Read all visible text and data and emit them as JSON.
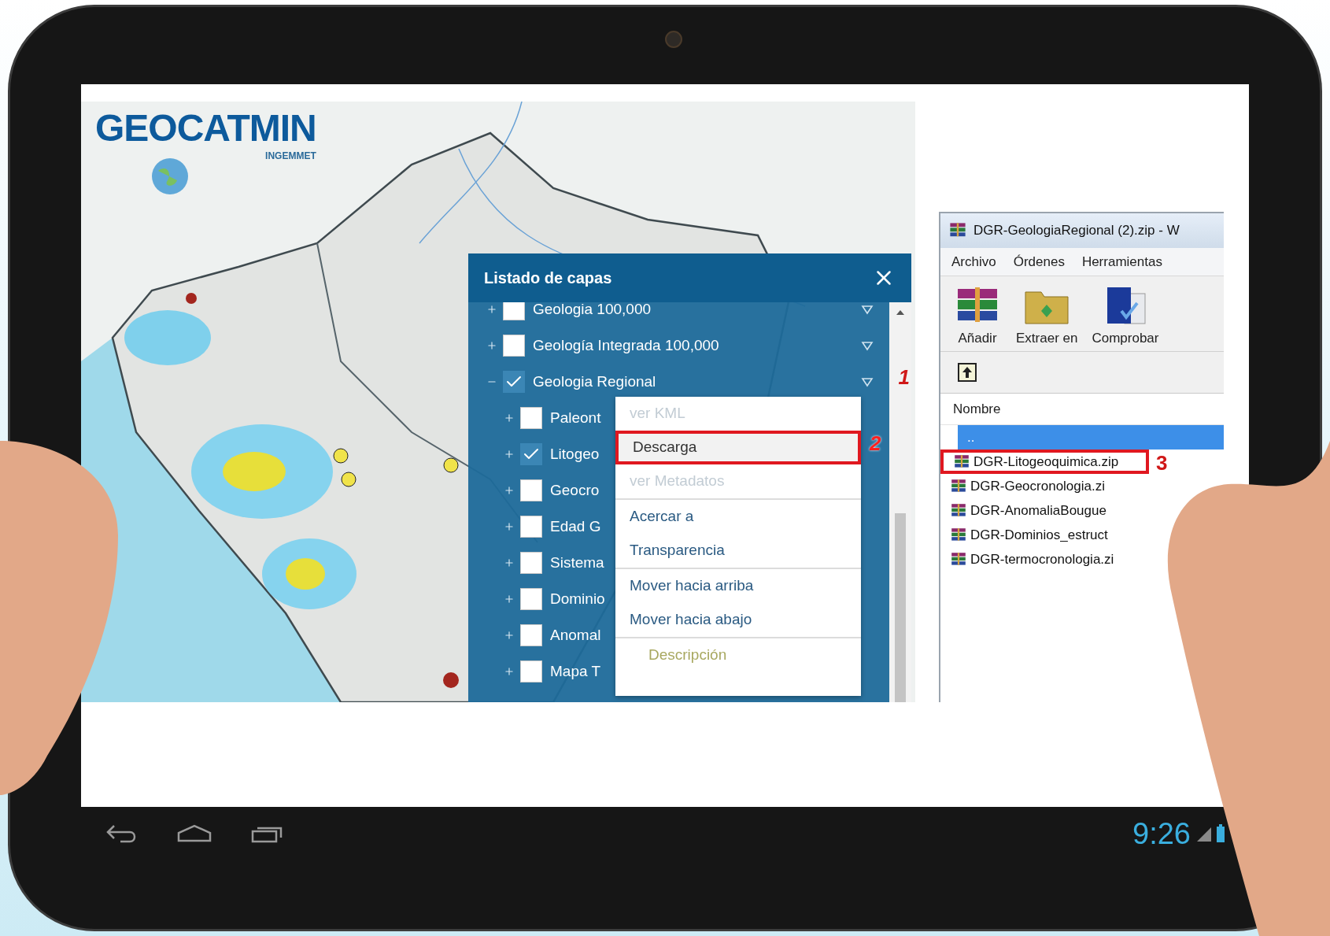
{
  "logo": {
    "name": "GEOCATMIN",
    "subtitle": "INGEMMET"
  },
  "layer_panel": {
    "title": "Listado de capas",
    "layers": [
      {
        "label": "Geologia 100,000",
        "checked": false,
        "expanded": false
      },
      {
        "label": "Geología Integrada 100,000",
        "checked": false,
        "expanded": false
      },
      {
        "label": "Geologia Regional",
        "checked": true,
        "expanded": true,
        "children": [
          {
            "label": "Paleont",
            "checked": false,
            "expanded": false
          },
          {
            "label": "Litogeo",
            "checked": true,
            "expanded": false
          },
          {
            "label": "Geocro",
            "checked": false,
            "expanded": false
          },
          {
            "label": "Edad G",
            "checked": false,
            "expanded": false
          },
          {
            "label": "Sistema",
            "checked": false,
            "expanded": false
          },
          {
            "label": "Dominio",
            "checked": false,
            "expanded": false
          },
          {
            "label": "Anomal",
            "checked": false,
            "expanded": false
          },
          {
            "label": "Mapa T",
            "checked": false,
            "expanded": false
          }
        ]
      }
    ],
    "context_menu": [
      [
        {
          "label": "ver KML",
          "kind": "item",
          "disabled": true,
          "highlighted": false
        },
        {
          "label": "Descarga",
          "kind": "item",
          "disabled": false,
          "highlighted": true
        },
        {
          "label": "ver Metadatos",
          "kind": "item",
          "disabled": true,
          "highlighted": false
        }
      ],
      [
        {
          "label": "Acercar a",
          "kind": "item",
          "disabled": false,
          "highlighted": false
        },
        {
          "label": "Transparencia",
          "kind": "item",
          "disabled": false,
          "highlighted": false
        }
      ],
      [
        {
          "label": "Mover hacia arriba",
          "kind": "item",
          "disabled": false,
          "highlighted": false
        },
        {
          "label": "Mover hacia abajo",
          "kind": "item",
          "disabled": false,
          "highlighted": false
        }
      ],
      [
        {
          "label": "Descripción",
          "kind": "heading",
          "disabled": false,
          "highlighted": false
        }
      ]
    ]
  },
  "annotations": [
    "1",
    "2",
    "3"
  ],
  "archive_window": {
    "title": "DGR-GeologiaRegional (2).zip - W",
    "menu": [
      "Archivo",
      "Órdenes",
      "Herramientas"
    ],
    "tools": [
      {
        "label": "Añadir",
        "kind": "add"
      },
      {
        "label": "Extraer en",
        "kind": "extract"
      },
      {
        "label": "Comprobar",
        "kind": "test"
      }
    ],
    "column": "Nombre",
    "files": [
      {
        "name": "..",
        "kind": "folder",
        "selected": true,
        "highlighted": false
      },
      {
        "name": "DGR-Litogeoquimica.zip",
        "kind": "archive",
        "selected": false,
        "highlighted": true
      },
      {
        "name": "DGR-Geocronologia.zi",
        "kind": "archive",
        "selected": false,
        "highlighted": false
      },
      {
        "name": "DGR-AnomaliaBougue",
        "kind": "archive",
        "selected": false,
        "highlighted": false
      },
      {
        "name": "DGR-Dominios_estruct",
        "kind": "archive",
        "selected": false,
        "highlighted": false
      },
      {
        "name": "DGR-termocronologia.zi",
        "kind": "archive",
        "selected": false,
        "highlighted": false
      }
    ]
  },
  "status_bar": {
    "time": "9:26"
  }
}
